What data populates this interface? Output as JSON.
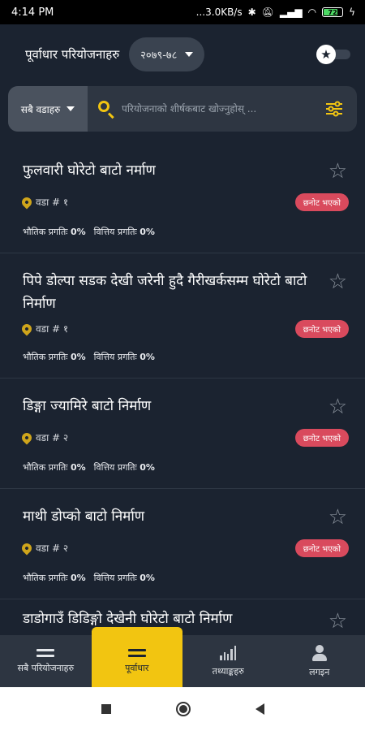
{
  "status_bar": {
    "time": "4:14 PM",
    "network_speed": "...3.0KB/s",
    "battery_level": "72",
    "battery_color": "#4cd964"
  },
  "header": {
    "title": "पूर्वाधार परियोजनाहरु",
    "year_selected": "२०७९-७८",
    "favorites_toggle_icon": "star-icon"
  },
  "search": {
    "ward_filter_label": "सबै वडाहरु",
    "placeholder": "परियोजनाको शीर्षकबाट खोज्नुहोस् ...",
    "search_icon": "search-icon",
    "filter_icon": "sliders-icon"
  },
  "labels": {
    "physical_progress": "भौतिक प्रगतिः",
    "financial_progress": "वित्तिय प्रगतिः"
  },
  "projects": [
    {
      "title": "फुलवारी घोरेटो बाटो नर्माण",
      "ward": "वडा # १",
      "status": "छनोट भएको",
      "physical_progress": "0%",
      "financial_progress": "0%"
    },
    {
      "title": "पिपे डोल्पा सडक देखी जरेनी हुदै गैरीखर्कसम्म घोरेटो बाटो निर्माण",
      "ward": "वडा # १",
      "status": "छनोट भएको",
      "physical_progress": "0%",
      "financial_progress": "0%"
    },
    {
      "title": "डिङ्गा ज्यामिरे बाटो निर्माण",
      "ward": "वडा # २",
      "status": "छनोट भएको",
      "physical_progress": "0%",
      "financial_progress": "0%"
    },
    {
      "title": "माथी डोप्को बाटो निर्माण",
      "ward": "वडा # २",
      "status": "छनोट भएको",
      "physical_progress": "0%",
      "financial_progress": "0%"
    },
    {
      "title": "डाडोगाउँ डिडिङ्गो देखेनी घोरेटो बाटो निर्माण",
      "ward": "",
      "status": "",
      "physical_progress": "",
      "financial_progress": ""
    }
  ],
  "bottom_nav": [
    {
      "label": "सबै परियोजनाहरु",
      "icon": "list-icon",
      "active": false
    },
    {
      "label": "पूर्वाधार",
      "icon": "list-icon",
      "active": true
    },
    {
      "label": "तथ्याङ्कहरु",
      "icon": "bar-chart-icon",
      "active": false
    },
    {
      "label": "लगइन",
      "icon": "user-icon",
      "active": false
    }
  ],
  "colors": {
    "background": "#1b2330",
    "accent": "#f2c511",
    "badge": "#d94a5d"
  }
}
